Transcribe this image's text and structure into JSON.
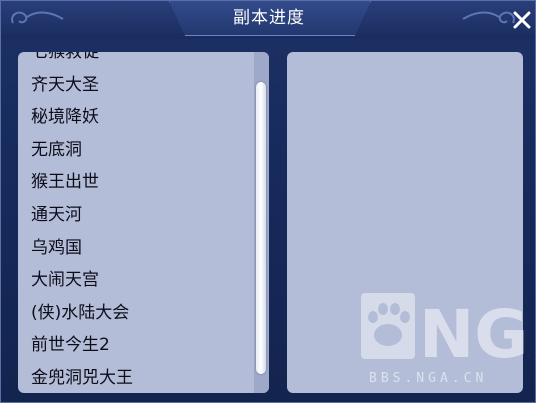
{
  "window": {
    "title": "副本进度",
    "close_glyph": "✕"
  },
  "list": {
    "items": [
      "七猴救徒",
      "齐天大圣",
      "秘境降妖",
      "无底洞",
      "猴王出世",
      "通天河",
      "乌鸡国",
      "大闹天宫",
      "(侠)水陆大会",
      "前世今生2",
      "金兜洞兕大王"
    ]
  },
  "watermark": {
    "logo_text": "NGA",
    "url_text": "BBS.NGA.CN"
  },
  "colors": {
    "panel": "#b4bdd8",
    "frame": "#1d3166",
    "title_text": "#ffffff",
    "item_text": "#0d0d1a"
  }
}
